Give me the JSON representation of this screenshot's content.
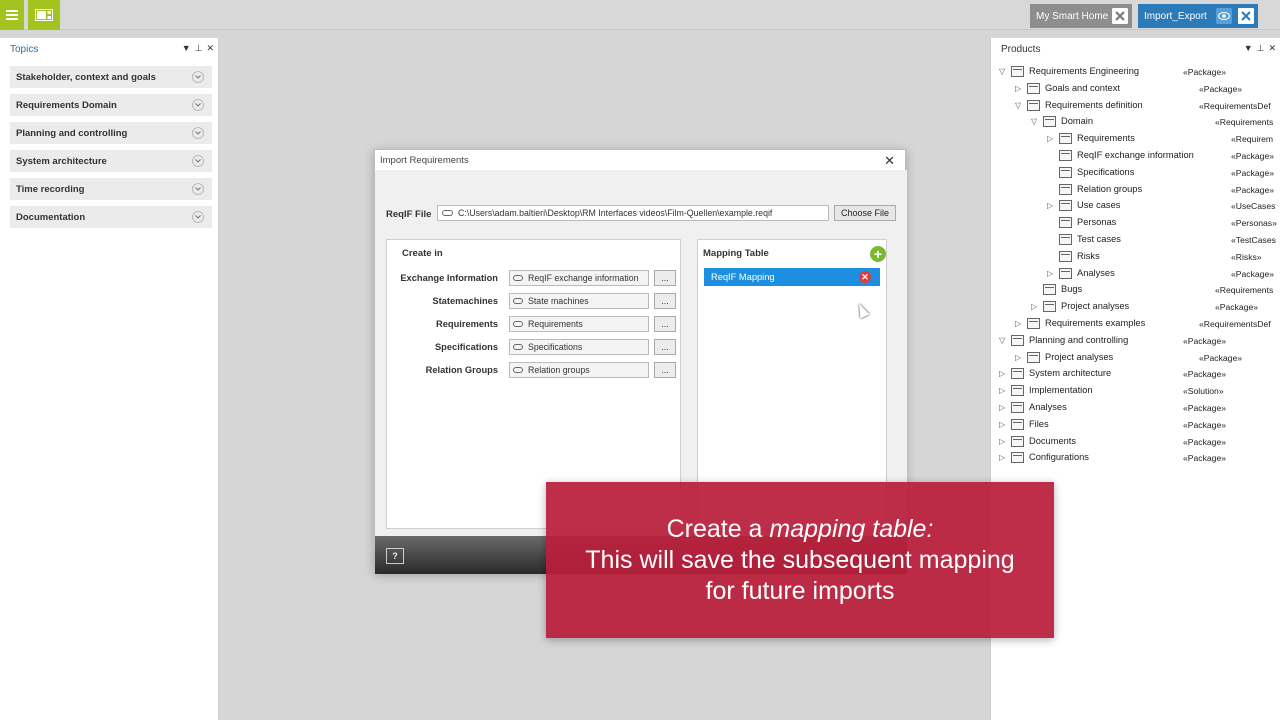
{
  "topbar": {
    "tabs": [
      {
        "label": "My Smart Home"
      },
      {
        "label": "Import_Export"
      }
    ]
  },
  "topics": {
    "title": "Topics",
    "items": [
      {
        "label": "Stakeholder, context and goals"
      },
      {
        "label": "Requirements Domain"
      },
      {
        "label": "Planning and controlling"
      },
      {
        "label": "System architecture"
      },
      {
        "label": "Time recording"
      },
      {
        "label": "Documentation"
      }
    ]
  },
  "products": {
    "title": "Products",
    "tree": [
      {
        "label": "Requirements Engineering",
        "stereo": "«Package»",
        "depth": 0,
        "expanded": true,
        "has_children": true
      },
      {
        "label": "Goals and context",
        "stereo": "«Package»",
        "depth": 1,
        "expanded": false,
        "has_children": true
      },
      {
        "label": "Requirements definition",
        "stereo": "«RequirementsDef",
        "depth": 1,
        "expanded": true,
        "has_children": true
      },
      {
        "label": "Domain",
        "stereo": "«Requirements",
        "depth": 2,
        "expanded": true,
        "has_children": true
      },
      {
        "label": "Requirements",
        "stereo": "«Requirem",
        "depth": 3,
        "expanded": false,
        "has_children": true
      },
      {
        "label": "ReqIF exchange information",
        "stereo": "«Package»",
        "depth": 3,
        "expanded": false,
        "has_children": false
      },
      {
        "label": "Specifications",
        "stereo": "«Package»",
        "depth": 3,
        "expanded": false,
        "has_children": false
      },
      {
        "label": "Relation groups",
        "stereo": "«Package»",
        "depth": 3,
        "expanded": false,
        "has_children": false
      },
      {
        "label": "Use cases",
        "stereo": "«UseCases",
        "depth": 3,
        "expanded": false,
        "has_children": true
      },
      {
        "label": "Personas",
        "stereo": "«Personas»",
        "depth": 3,
        "expanded": false,
        "has_children": false
      },
      {
        "label": "Test cases",
        "stereo": "«TestCases",
        "depth": 3,
        "expanded": false,
        "has_children": false
      },
      {
        "label": "Risks",
        "stereo": "«Risks»",
        "depth": 3,
        "expanded": false,
        "has_children": false
      },
      {
        "label": "Analyses",
        "stereo": "«Package»",
        "depth": 3,
        "expanded": false,
        "has_children": true
      },
      {
        "label": "Bugs",
        "stereo": "«Requirements",
        "depth": 2,
        "expanded": false,
        "has_children": false
      },
      {
        "label": "Project analyses",
        "stereo": "«Package»",
        "depth": 2,
        "expanded": false,
        "has_children": true
      },
      {
        "label": "Requirements examples",
        "stereo": "«RequirementsDef",
        "depth": 1,
        "expanded": false,
        "has_children": true
      },
      {
        "label": "Planning and controlling",
        "stereo": "«Package»",
        "depth": 0,
        "expanded": true,
        "has_children": true
      },
      {
        "label": "Project analyses",
        "stereo": "«Package»",
        "depth": 1,
        "expanded": false,
        "has_children": true
      },
      {
        "label": "System architecture",
        "stereo": "«Package»",
        "depth": 0,
        "expanded": false,
        "has_children": true
      },
      {
        "label": "Implementation",
        "stereo": "«Solution»",
        "depth": 0,
        "expanded": false,
        "has_children": true
      },
      {
        "label": "Analyses",
        "stereo": "«Package»",
        "depth": 0,
        "expanded": false,
        "has_children": true
      },
      {
        "label": "Files",
        "stereo": "«Package»",
        "depth": 0,
        "expanded": false,
        "has_children": true
      },
      {
        "label": "Documents",
        "stereo": "«Package»",
        "depth": 0,
        "expanded": false,
        "has_children": true
      },
      {
        "label": "Configurations",
        "stereo": "«Package»",
        "depth": 0,
        "expanded": false,
        "has_children": true
      }
    ]
  },
  "dialog": {
    "title": "Import Requirements",
    "reqif_label": "ReqIF File",
    "reqif_path": "C:\\Users\\adam.baltieri\\Desktop\\RM Interfaces videos\\Film-Quellen\\example.reqif",
    "choose_file_label": "Choose File",
    "create_in_title": "Create in",
    "rows": [
      {
        "label": "Exchange Information",
        "value": "ReqIF exchange information",
        "button": "..."
      },
      {
        "label": "Statemachines",
        "value": "State machines",
        "button": "..."
      },
      {
        "label": "Requirements",
        "value": "Requirements",
        "button": "..."
      },
      {
        "label": "Specifications",
        "value": "Specifications",
        "button": "..."
      },
      {
        "label": "Relation Groups",
        "value": "Relation groups",
        "button": "..."
      }
    ],
    "mapping_title": "Mapping Table",
    "mapping_items": [
      {
        "label": "ReqIF Mapping"
      }
    ],
    "help_label": "?"
  },
  "caption": {
    "line1_prefix": "Create a ",
    "line1_em": "mapping table:",
    "line2": "This will save the subsequent mapping",
    "line3": "for future imports"
  },
  "colors": {
    "accent_green": "#a3c41e",
    "tab_active": "#2c7ab8",
    "selection_blue": "#1e8fe0",
    "caption_red": "#b91e3a"
  }
}
